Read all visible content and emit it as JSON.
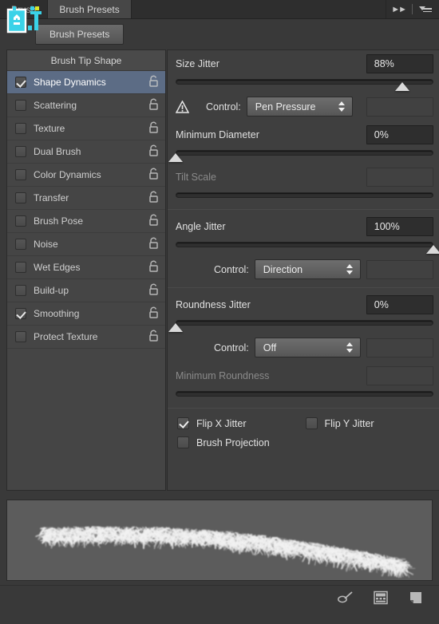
{
  "window": {
    "tabs": [
      {
        "label": "Brush",
        "active": false
      },
      {
        "label": "Brush Presets",
        "active": true
      }
    ],
    "collapse_icon": "double-chevron-right-icon",
    "menu_icon": "panel-menu-icon",
    "watermark_alt": "roudingwang-logo"
  },
  "toolbar": {
    "preset_button": "Brush Presets"
  },
  "sidebar": {
    "header": "Brush Tip Shape",
    "items": [
      {
        "label": "Shape Dynamics",
        "checked": true,
        "selected": true
      },
      {
        "label": "Scattering",
        "checked": false,
        "selected": false
      },
      {
        "label": "Texture",
        "checked": false,
        "selected": false
      },
      {
        "label": "Dual Brush",
        "checked": false,
        "selected": false
      },
      {
        "label": "Color Dynamics",
        "checked": false,
        "selected": false
      },
      {
        "label": "Transfer",
        "checked": false,
        "selected": false
      },
      {
        "label": "Brush Pose",
        "checked": false,
        "selected": false
      },
      {
        "label": "Noise",
        "checked": false,
        "selected": false
      },
      {
        "label": "Wet Edges",
        "checked": false,
        "selected": false
      },
      {
        "label": "Build-up",
        "checked": false,
        "selected": false
      },
      {
        "label": "Smoothing",
        "checked": true,
        "selected": false
      },
      {
        "label": "Protect Texture",
        "checked": false,
        "selected": false
      }
    ]
  },
  "settings": {
    "size_jitter": {
      "label": "Size Jitter",
      "value": "88%",
      "slider_pct": 88
    },
    "size_control": {
      "label": "Control:",
      "value": "Pen Pressure",
      "warning": true
    },
    "minimum_diameter": {
      "label": "Minimum Diameter",
      "value": "0%",
      "slider_pct": 0
    },
    "tilt_scale": {
      "label": "Tilt Scale",
      "value": "",
      "disabled": true
    },
    "angle_jitter": {
      "label": "Angle Jitter",
      "value": "100%",
      "slider_pct": 100
    },
    "angle_control": {
      "label": "Control:",
      "value": "Direction",
      "warning": false
    },
    "roundness_jitter": {
      "label": "Roundness Jitter",
      "value": "0%",
      "slider_pct": 0
    },
    "roundness_control": {
      "label": "Control:",
      "value": "Off",
      "warning": false
    },
    "minimum_roundness": {
      "label": "Minimum Roundness",
      "value": "",
      "disabled": true
    },
    "flip_x_jitter": {
      "label": "Flip X Jitter",
      "checked": true
    },
    "flip_y_jitter": {
      "label": "Flip Y Jitter",
      "checked": false
    },
    "brush_projection": {
      "label": "Brush Projection",
      "checked": false
    }
  },
  "footer": {
    "icons": [
      "toggle-brush-options-icon",
      "new-brush-preset-icon",
      "create-new-brush-icon"
    ]
  },
  "colors": {
    "panel_bg": "#393939",
    "selection": "#5c6c85",
    "value_bg": "#2e2e2e",
    "preview_bg": "#5c5c5c",
    "watermark": "#3ad2e8"
  }
}
